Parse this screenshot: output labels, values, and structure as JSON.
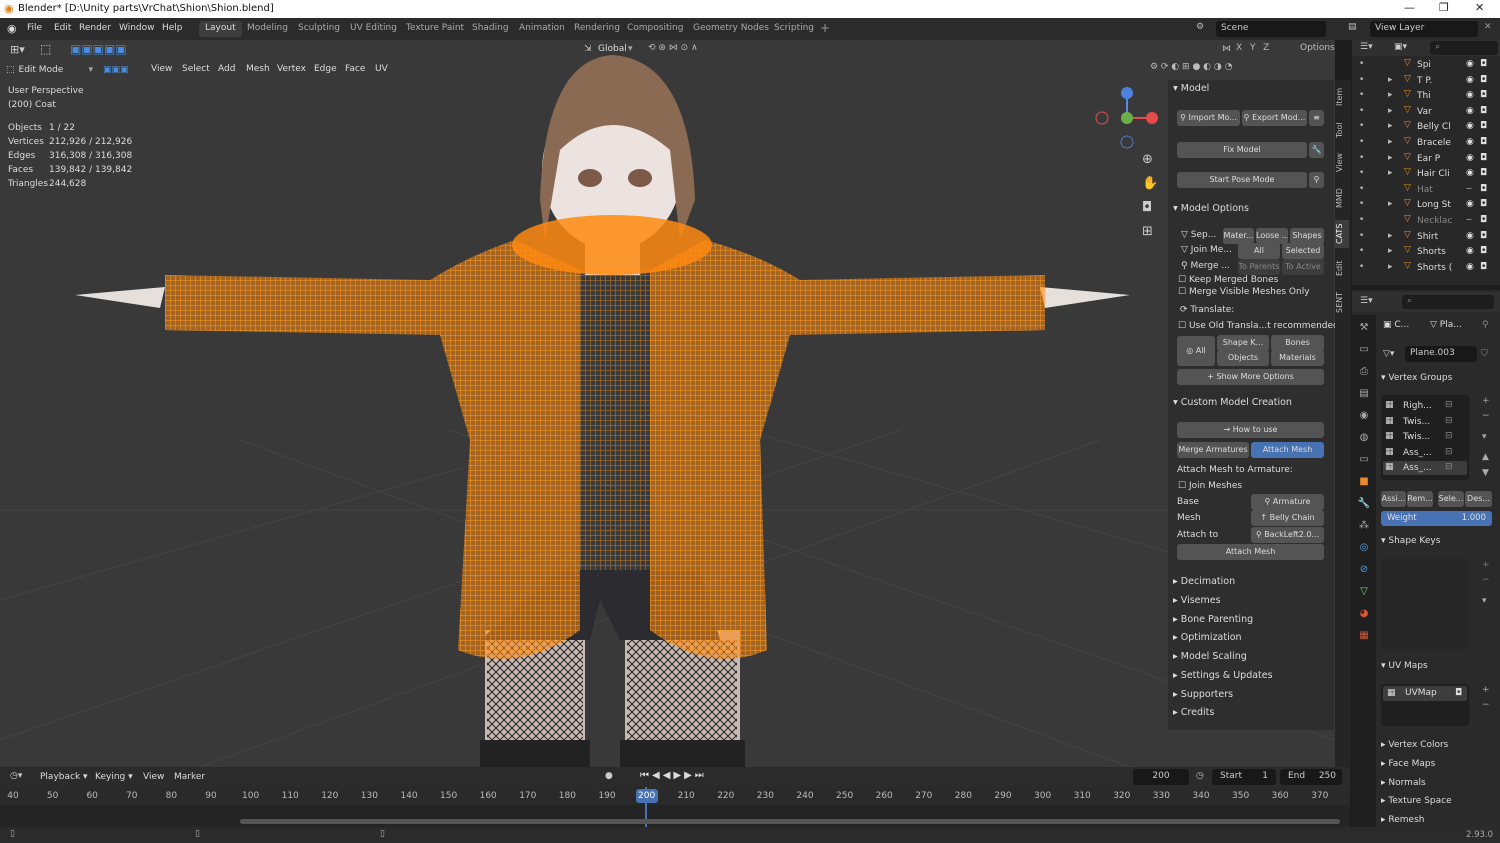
{
  "window": {
    "title": "Blender* [D:\\Unity parts\\VrChat\\Shion\\Shion.blend]"
  },
  "menu": [
    "File",
    "Edit",
    "Render",
    "Window",
    "Help"
  ],
  "workspaces": [
    "Layout",
    "Modeling",
    "Sculpting",
    "UV Editing",
    "Texture Paint",
    "Shading",
    "Animation",
    "Rendering",
    "Compositing",
    "Geometry Nodes",
    "Scripting"
  ],
  "scene": "Scene",
  "view_layer": "View Layer",
  "toolbar": {
    "orientation": "Global",
    "options": "Options",
    "axes": [
      "X",
      "Y",
      "Z"
    ]
  },
  "viewport_header": {
    "mode": "Edit Mode",
    "menus": [
      "View",
      "Select",
      "Add",
      "Mesh",
      "Vertex",
      "Edge",
      "Face",
      "UV"
    ]
  },
  "viewport_info": {
    "perspective": "User Perspective",
    "object": "(200) Coat",
    "stats": [
      [
        "Objects",
        "1 / 22"
      ],
      [
        "Vertices",
        "212,926 / 212,926"
      ],
      [
        "Edges",
        "316,308 / 316,308"
      ],
      [
        "Faces",
        "139,842 / 139,842"
      ],
      [
        "Triangles",
        "244,628"
      ]
    ]
  },
  "side_tabs": [
    "Item",
    "Tool",
    "View",
    "MMD",
    "CATS",
    "Edit",
    "SENT"
  ],
  "cats": {
    "model_header": "Model",
    "import": "Import Mo...",
    "export": "Export Mod...",
    "fix": "Fix Model",
    "pose": "Start Pose Mode",
    "options_header": "Model Options",
    "sep": "Sep...",
    "sep_opts": [
      "Mater...",
      "Loose ...",
      "Shapes"
    ],
    "join": "Join Me...",
    "join_opts": [
      "All",
      "Selected"
    ],
    "merge": "Merge ...",
    "merge_opts": [
      "To Parents",
      "To Active"
    ],
    "keep_bones": "Keep Merged Bones",
    "merge_visible": "Merge Visible Meshes Only",
    "translate": "Translate:",
    "old_translate": "Use Old Transla...t recommended)",
    "trans_all": "All",
    "trans_opts": [
      "Shape K...",
      "Bones",
      "Objects",
      "Materials"
    ],
    "more": "Show More Options",
    "custom_header": "Custom Model Creation",
    "how": "How to use",
    "merge_arm": "Merge Armatures",
    "attach_tab": "Attach Mesh",
    "attach_label": "Attach Mesh to Armature:",
    "join_meshes": "Join Meshes",
    "base_l": "Base",
    "base_v": "Armature",
    "mesh_l": "Mesh",
    "mesh_v": "Belly Chain",
    "attach_l": "Attach to",
    "attach_v": "BackLeft2.0...",
    "attach_btn": "Attach Mesh",
    "collapsed": [
      "Decimation",
      "Visemes",
      "Bone Parenting",
      "Optimization",
      "Model Scaling",
      "Settings & Updates",
      "Supporters",
      "Credits"
    ]
  },
  "outliner": [
    {
      "name": "Spi",
      "vis": true,
      "exp": false
    },
    {
      "name": "T P.",
      "vis": true,
      "exp": true
    },
    {
      "name": "Thi",
      "vis": true,
      "exp": true
    },
    {
      "name": "Var",
      "vis": true,
      "exp": true
    },
    {
      "name": "Belly Cl",
      "vis": true,
      "exp": true
    },
    {
      "name": "Bracele",
      "vis": true,
      "exp": true
    },
    {
      "name": "Ear P",
      "vis": true,
      "exp": true
    },
    {
      "name": "Hair Cli",
      "vis": true,
      "exp": true
    },
    {
      "name": "Hat",
      "vis": false,
      "exp": false
    },
    {
      "name": "Long St",
      "vis": true,
      "exp": true
    },
    {
      "name": "Necklac",
      "vis": false,
      "exp": false
    },
    {
      "name": "Shirt",
      "vis": true,
      "exp": true
    },
    {
      "name": "Shorts",
      "vis": true,
      "exp": true
    },
    {
      "name": "Shorts (",
      "vis": true,
      "exp": true
    }
  ],
  "props": {
    "crumb1": "C...",
    "crumb2": "Pla...",
    "mesh_name": "Plane.003",
    "vgroups_header": "Vertex Groups",
    "vgroups": [
      "Righ...",
      "Twis...",
      "Twis...",
      "Ass_...",
      "Ass_..."
    ],
    "vg_btns": [
      "Assi...",
      "Rem...",
      "Sele...",
      "Des..."
    ],
    "weight_label": "Weight",
    "weight_value": "1.000",
    "shape_keys": "Shape Keys",
    "uv_maps": "UV Maps",
    "uv_item": "UVMap",
    "collapsed": [
      "Vertex Colors",
      "Face Maps",
      "Normals",
      "Texture Space",
      "Remesh"
    ]
  },
  "timeline": {
    "menus": [
      "Playback",
      "Keying",
      "View",
      "Marker"
    ],
    "current": "200",
    "start_label": "Start",
    "start": "1",
    "end_label": "End",
    "end": "250",
    "ticks": [
      "40",
      "50",
      "60",
      "70",
      "80",
      "90",
      "100",
      "110",
      "120",
      "130",
      "140",
      "150",
      "160",
      "170",
      "180",
      "190",
      "200",
      "210",
      "220",
      "230",
      "240",
      "250",
      "260",
      "270",
      "280",
      "290",
      "300",
      "310",
      "320",
      "330",
      "340",
      "350",
      "360",
      "370"
    ]
  },
  "version": "2.93.0",
  "colors": {
    "accent": "#4772b3",
    "selection": "#ff8a10"
  }
}
